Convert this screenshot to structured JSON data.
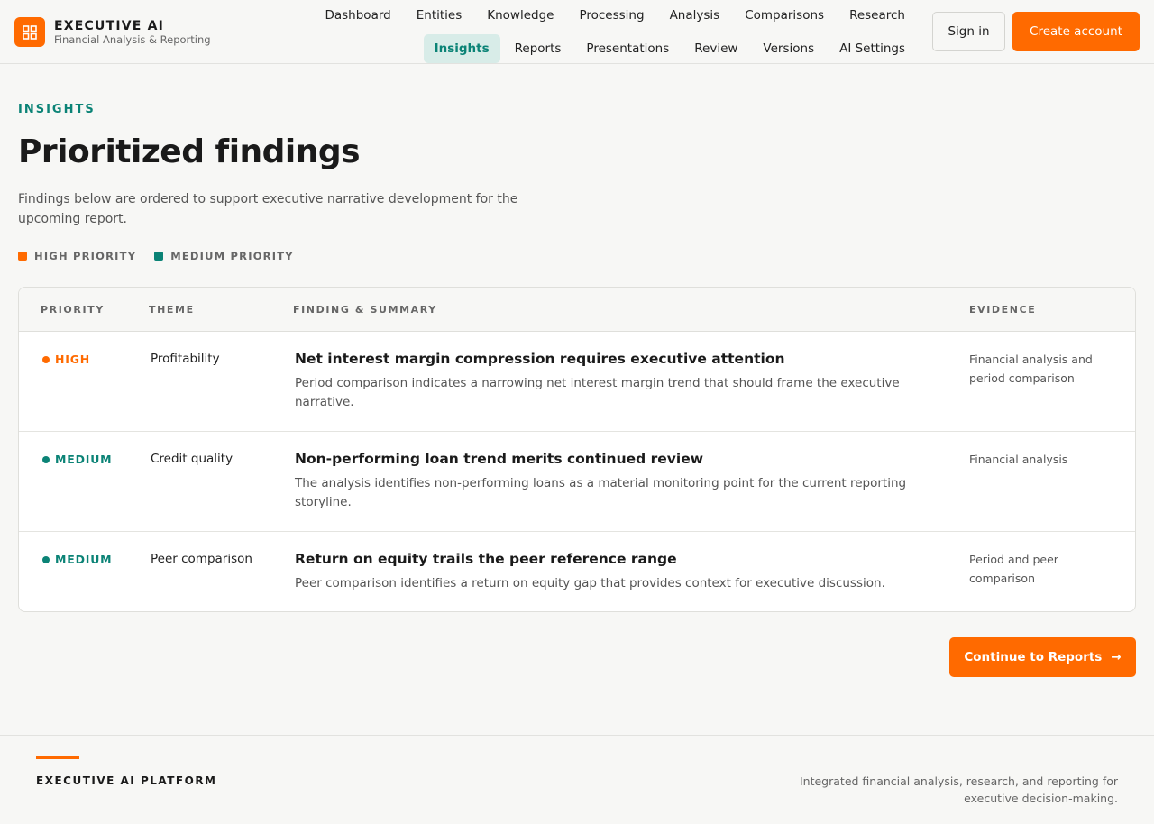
{
  "brand": {
    "name": "EXECUTIVE AI",
    "subtitle": "Financial Analysis & Reporting"
  },
  "nav": {
    "row1": [
      "Dashboard",
      "Entities",
      "Knowledge",
      "Processing",
      "Analysis",
      "Comparisons",
      "Research"
    ],
    "row2": [
      "Insights",
      "Reports",
      "Presentations",
      "Review",
      "Versions",
      "AI Settings"
    ],
    "active": "Insights"
  },
  "auth": {
    "sign_in": "Sign in",
    "create_account": "Create account"
  },
  "page": {
    "eyebrow": "INSIGHTS",
    "title": "Prioritized findings",
    "description": "Findings below are ordered to support executive narrative development for the upcoming report."
  },
  "legend": [
    {
      "label": "HIGH PRIORITY",
      "color": "#ff6a00"
    },
    {
      "label": "MEDIUM PRIORITY",
      "color": "#0b8376"
    }
  ],
  "table": {
    "headers": {
      "priority": "PRIORITY",
      "theme": "THEME",
      "finding": "FINDING & SUMMARY",
      "evidence": "EVIDENCE"
    },
    "rows": [
      {
        "priority": "HIGH",
        "priority_color": "#ff6a00",
        "theme": "Profitability",
        "title": "Net interest margin compression requires executive attention",
        "summary": "Period comparison indicates a narrowing net interest margin trend that should frame the executive narrative.",
        "evidence": "Financial analysis and period comparison"
      },
      {
        "priority": "MEDIUM",
        "priority_color": "#0b8376",
        "theme": "Credit quality",
        "title": "Non-performing loan trend merits continued review",
        "summary": "The analysis identifies non-performing loans as a material monitoring point for the current reporting storyline.",
        "evidence": "Financial analysis"
      },
      {
        "priority": "MEDIUM",
        "priority_color": "#0b8376",
        "theme": "Peer comparison",
        "title": "Return on equity trails the peer reference range",
        "summary": "Peer comparison identifies a return on equity gap that provides context for executive discussion.",
        "evidence": "Period and peer comparison"
      }
    ]
  },
  "cta": {
    "continue": "Continue to Reports",
    "arrow": "→"
  },
  "footer": {
    "name": "EXECUTIVE AI PLATFORM",
    "tagline": "Integrated financial analysis, research, and reporting for executive decision-making."
  }
}
